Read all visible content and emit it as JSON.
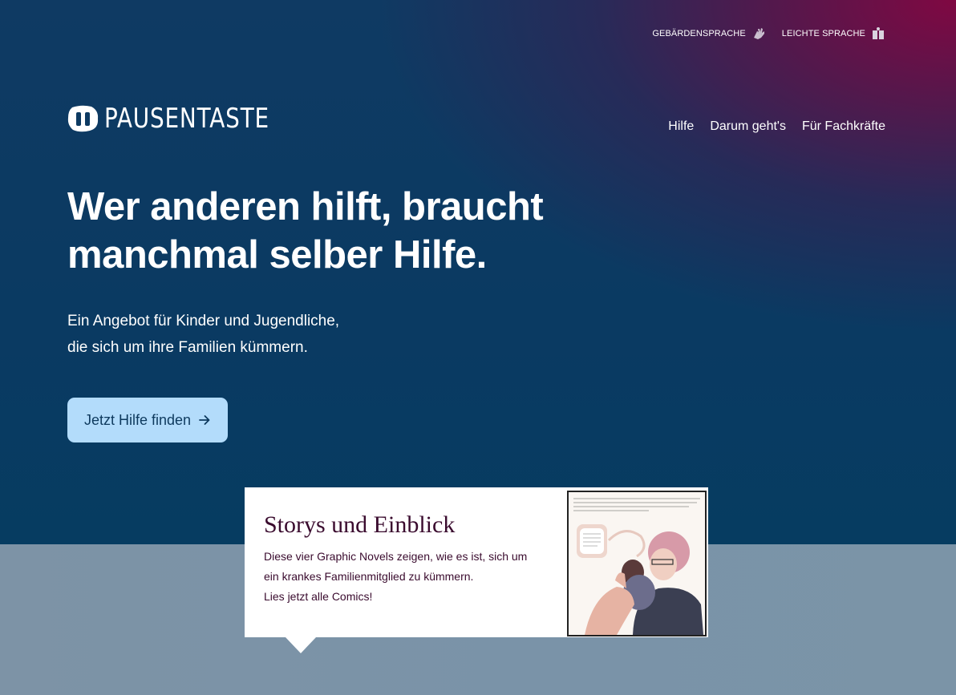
{
  "utility_nav": {
    "sign_language": {
      "label": "GEBÄRDENSPRACHE",
      "icon": "sign-language-hand-icon"
    },
    "easy_language": {
      "label": "LEICHTE SPRACHE",
      "icon": "easy-language-book-icon"
    }
  },
  "logo": {
    "text": "PAUSENTASTE"
  },
  "main_nav": [
    {
      "label": "Hilfe"
    },
    {
      "label": "Darum geht's"
    },
    {
      "label": "Für Fachkräfte"
    }
  ],
  "hero": {
    "headline_line1": "Wer anderen hilft, braucht",
    "headline_line2": "manchmal selber Hilfe.",
    "subline_line1": "Ein Angebot für Kinder und Jugendliche,",
    "subline_line2": "die sich um ihre Familien kümmern.",
    "cta_label": "Jetzt Hilfe finden",
    "cta_icon": "arrow-right-icon"
  },
  "story_card": {
    "title": "Storys und Einblick",
    "text_line1": "Diese vier Graphic Novels zeigen, wie es ist, sich um",
    "text_line2": "ein krankes Familienmitglied zu kümmern.",
    "text_line3": "Lies jetzt alle Comics!"
  },
  "colors": {
    "hero_blue": "#0a3a62",
    "hero_magenta": "#800842",
    "lower_band": "#7a93a8",
    "cta_bg": "#b3dcfb",
    "cta_text": "#0e3a5e",
    "card_title": "#3a0b2e"
  }
}
